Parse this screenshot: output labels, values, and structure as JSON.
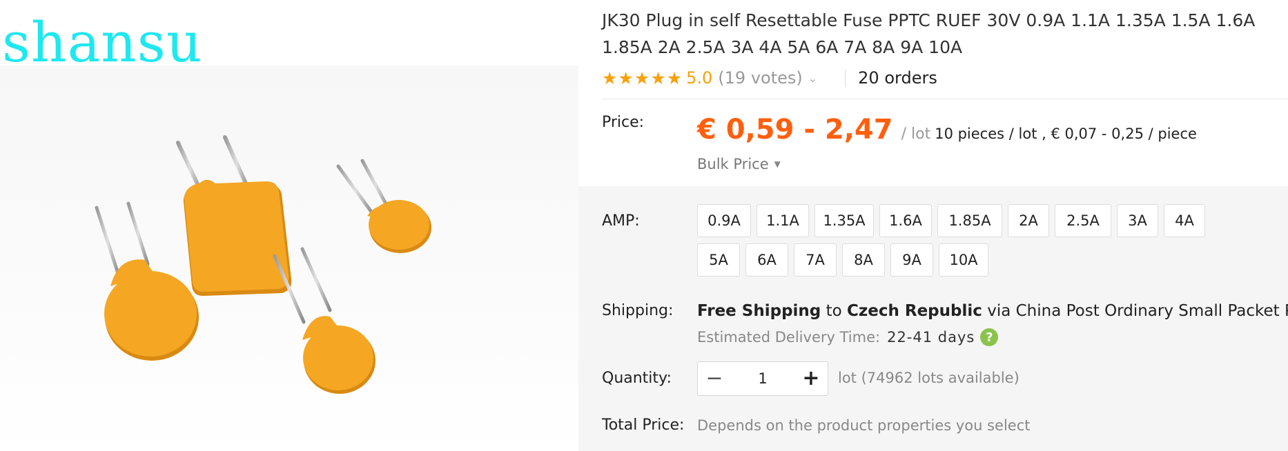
{
  "watermark": "shansu",
  "product": {
    "title": "JK30 Plug in self Resettable Fuse PPTC RUEF 30V 0.9A 1.1A 1.35A 1.5A 1.6A 1.85A 2A 2.5A 3A 4A 5A 6A 7A 8A 9A 10A"
  },
  "rating": {
    "stars": 5,
    "score": "5.0",
    "votes": "(19 votes)",
    "orders": "20 orders"
  },
  "price": {
    "label": "Price:",
    "range": "€ 0,59 - 2,47",
    "per_unit": "/ lot",
    "detail": "10 pieces / lot , € 0,07 - 0,25 / piece",
    "bulk_label": "Bulk Price"
  },
  "amp": {
    "label": "AMP:",
    "options": [
      "0.9A",
      "1.1A",
      "1.35A",
      "1.6A",
      "1.85A",
      "2A",
      "2.5A",
      "3A",
      "4A",
      "5A",
      "6A",
      "7A",
      "8A",
      "9A",
      "10A"
    ]
  },
  "shipping": {
    "label": "Shipping:",
    "free_text": "Free Shipping",
    "to_text": "to",
    "destination": "Czech Republic",
    "via_text": "via",
    "carrier": "China Post Ordinary Small Packet Plus",
    "delivery_label": "Estimated Delivery Time:",
    "delivery_days": "22-41 days"
  },
  "quantity": {
    "label": "Quantity:",
    "value": "1",
    "available": "lot (74962 lots available)"
  },
  "total": {
    "label": "Total Price:",
    "value": "Depends on the product properties you select"
  },
  "colors": {
    "price": "#ff5f0d",
    "star": "#f7a10b",
    "watermark": "#1ee8f0",
    "fuse": "#f5a623",
    "help_icon": "#8bc34a"
  },
  "icons": {
    "star": "star-icon",
    "chevron": "chevron-down-icon",
    "caret": "caret-down-icon",
    "help": "question-mark-icon",
    "minus": "minus-icon",
    "plus": "plus-icon"
  }
}
